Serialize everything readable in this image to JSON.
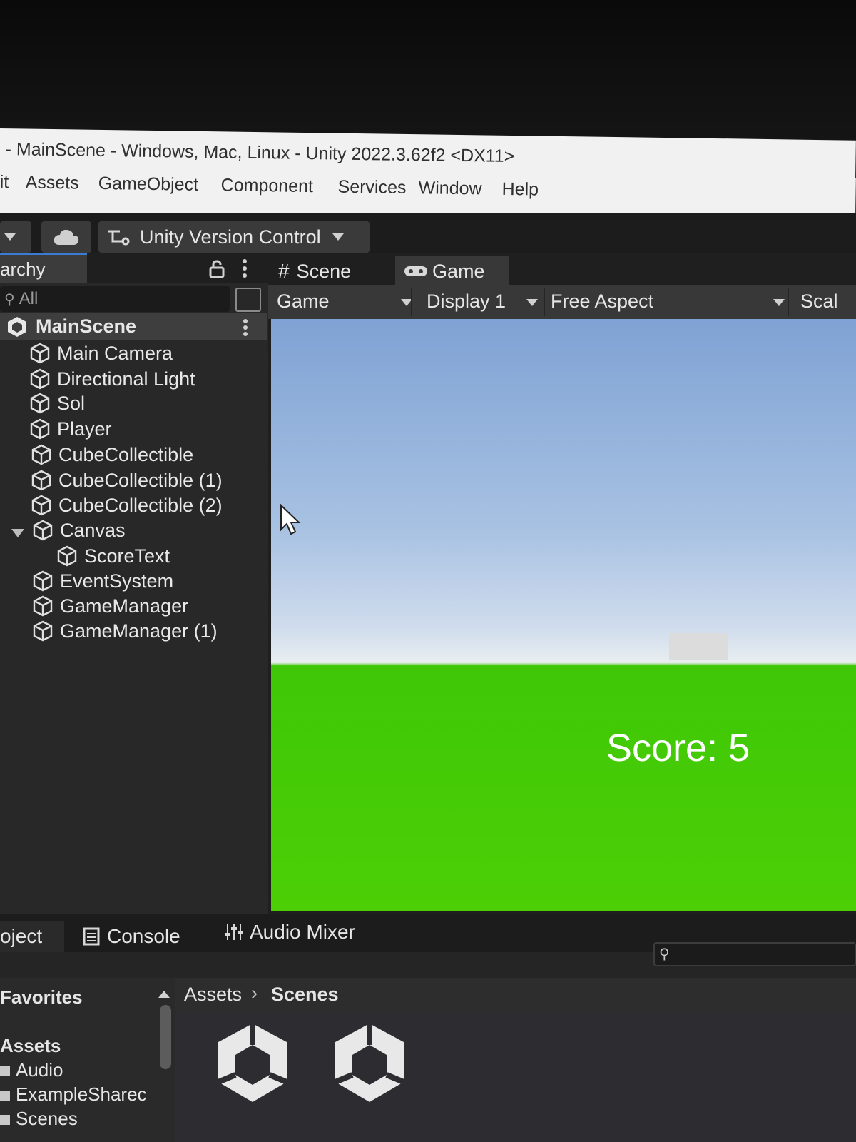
{
  "window": {
    "title": "- MainScene - Windows, Mac, Linux - Unity 2022.3.62f2 <DX11>"
  },
  "menu": [
    "it",
    "Assets",
    "GameObject",
    "Component",
    "Services",
    "Window",
    "Help"
  ],
  "toolbar": {
    "version_control_label": "Unity Version Control"
  },
  "hierarchy": {
    "tab_label": "archy",
    "search_label": "All",
    "scene_name": "MainScene",
    "items": [
      {
        "label": "Main Camera"
      },
      {
        "label": "Directional Light"
      },
      {
        "label": "Sol"
      },
      {
        "label": "Player"
      },
      {
        "label": "CubeCollectible"
      },
      {
        "label": "CubeCollectible (1)"
      },
      {
        "label": "CubeCollectible (2)"
      },
      {
        "label": "Canvas",
        "expanded": true
      },
      {
        "label": "ScoreText",
        "child_of": "Canvas"
      },
      {
        "label": "EventSystem"
      },
      {
        "label": "GameManager"
      },
      {
        "label": "GameManager (1)"
      }
    ]
  },
  "center": {
    "tabs": [
      {
        "label": "Scene",
        "active": false
      },
      {
        "label": "Game",
        "active": true
      }
    ],
    "view_dropdown": "Game",
    "display_dropdown": "Display 1",
    "aspect_dropdown": "Free Aspect",
    "scale_label": "Scal",
    "score_text": "Score: 5"
  },
  "bottom": {
    "tabs": [
      {
        "label": "oject"
      },
      {
        "label": "Console"
      },
      {
        "label": "Audio Mixer"
      }
    ],
    "favorites_label": "Favorites",
    "assets_label": "Assets",
    "folders": [
      "Audio",
      "ExampleSharec",
      "Scenes"
    ],
    "breadcrumb": [
      "Assets",
      "Scenes"
    ]
  },
  "colors": {
    "sky_top": "#7fa2d4",
    "ground": "#4ccf05",
    "panel": "#282828",
    "accent": "#3a7bd5"
  }
}
